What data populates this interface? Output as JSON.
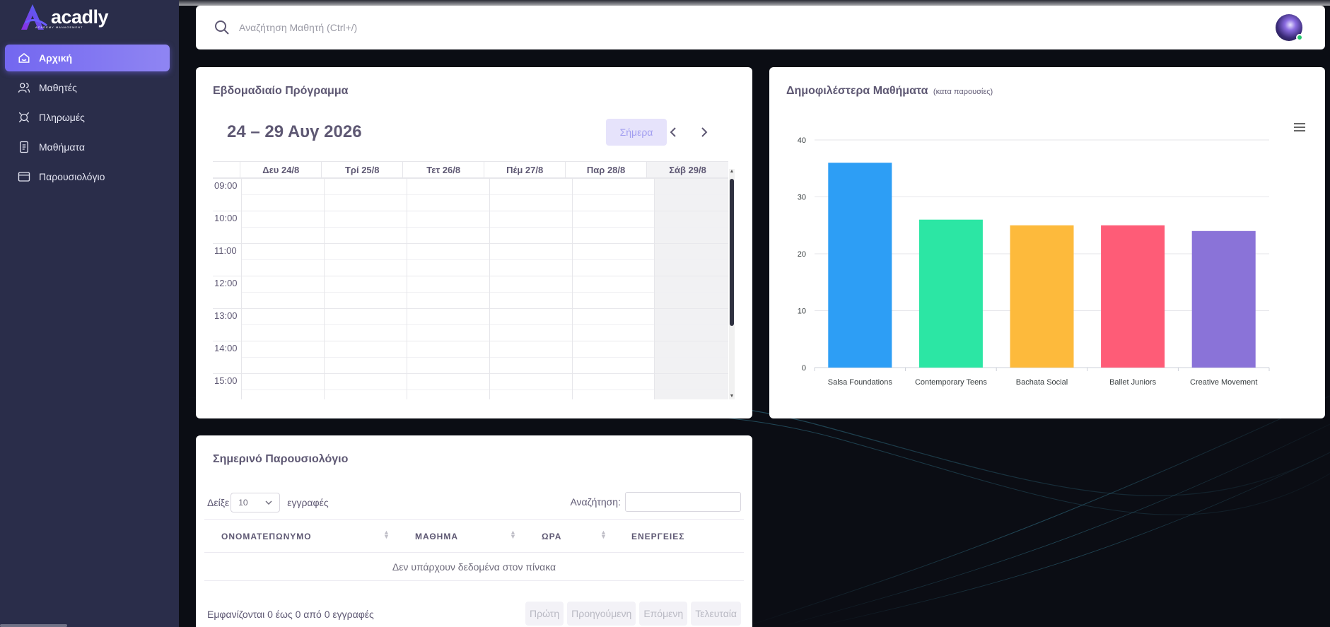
{
  "app": {
    "logo_text": "acadly",
    "logo_subtitle": "ACADEMY MANAGEMENT"
  },
  "sidebar": {
    "items": [
      {
        "label": "Αρχική",
        "icon": "home-icon",
        "active": true
      },
      {
        "label": "Μαθητές",
        "icon": "users-icon",
        "active": false
      },
      {
        "label": "Πληρωμές",
        "icon": "payments-icon",
        "active": false
      },
      {
        "label": "Μαθήματα",
        "icon": "courses-icon",
        "active": false
      },
      {
        "label": "Παρουσιολόγιο",
        "icon": "attendance-icon",
        "active": false
      }
    ]
  },
  "topbar": {
    "search_placeholder": "Αναζήτηση Μαθητή (Ctrl+/)",
    "avatar_status_color": "#28c76f"
  },
  "schedule": {
    "title": "Εβδομαδιαίο Πρόγραμμα",
    "range": "24 – 29 Αυγ 2026",
    "today_label": "Σήμερα",
    "days": [
      "Δευ 24/8",
      "Τρί 25/8",
      "Τετ 26/8",
      "Πέμ 27/8",
      "Παρ 28/8",
      "Σάβ 29/8"
    ],
    "times": [
      "09:00",
      "10:00",
      "11:00",
      "12:00",
      "13:00",
      "14:00",
      "15:00"
    ]
  },
  "popular": {
    "title": "Δημοφιλέστερα Μαθήματα",
    "subtitle": "(κατα παρουσίες)",
    "menu_icon": "hamburger-icon"
  },
  "chart_data": {
    "type": "bar",
    "categories": [
      "Salsa Foundations",
      "Contemporary Teens",
      "Bachata Social",
      "Ballet Juniors",
      "Creative Movement"
    ],
    "values": [
      36,
      26,
      25,
      25,
      24
    ],
    "colors": [
      "#2d9ef5",
      "#2ce6a4",
      "#fdba3c",
      "#fe5c77",
      "#8a73d8"
    ],
    "ylim": [
      0,
      40
    ],
    "yticks": [
      0,
      10,
      20,
      30,
      40
    ],
    "grid": true,
    "legend": "none"
  },
  "attendance": {
    "title": "Σημερινό Παρουσιολόγιο",
    "show_label": "Δείξε",
    "page_size": "10",
    "entries_label": "εγγραφές",
    "search_label": "Αναζήτηση:",
    "columns": [
      "ΟΝΟΜΑΤΕΠΩΝΥΜΟ",
      "ΜΑΘΗΜΑ",
      "ΩΡΑ",
      "ΕΝΕΡΓΕΙΕΣ"
    ],
    "empty_message": "Δεν υπάρχουν δεδομένα στον πίνακα",
    "info": "Εμφανίζονται 0 έως 0 από 0 εγγραφές",
    "pager": [
      "Πρώτη",
      "Προηγούμενη",
      "Επόμενη",
      "Τελευταία"
    ]
  }
}
